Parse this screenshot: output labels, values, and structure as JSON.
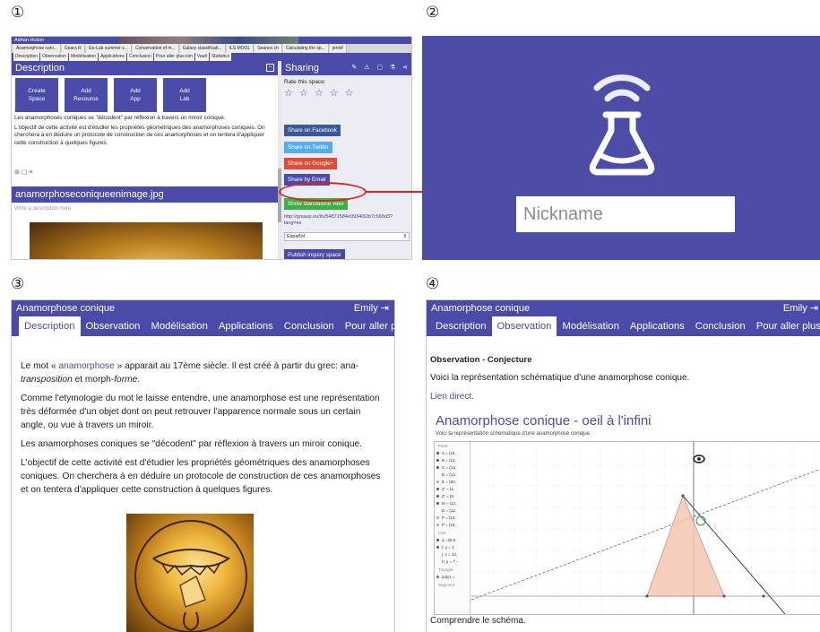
{
  "panel_labels": [
    "①",
    "②",
    "③",
    "④"
  ],
  "p1": {
    "user_name": "Adrian Holzer",
    "top_tabs": [
      "Anamorphose coni...",
      "Geara R",
      "Go-Lab summer s...",
      "Conservation of m...",
      "Galaxy classificati...",
      "ILS MOOL",
      "Seance.ch",
      "Calculating the sp...",
      "jennif"
    ],
    "sub_tabs": [
      "Description",
      "Observation",
      "Modélisation",
      "Applications",
      "Conclusion",
      "Pour aller plus loin",
      "Vault",
      "Statistics"
    ],
    "description_title": "Description",
    "actions": [
      "Create\nSpace",
      "Add\nResource",
      "Add\nApp",
      "Add\nLab"
    ],
    "desc_text_1": "Les anamorphoses coniques se \"décodent\" par réflexion à travers un miroir conique.",
    "desc_text_2": "L'objectif de cette activité est d'étudier les propriétés géométriques des anamorphoses coniques. On cherchera à en déduire un protocole de construction de ces anamorphoses et on tentera d'appliquer cette construction à quelques figures.",
    "mini_icons": "⊞ ▢ ≡",
    "file_title": "anamorphoseconiqueenimage.jpg",
    "file_placeholder": "Write a description here",
    "sharing_title": "Sharing",
    "sharing_tools": "✎ ⚠ ▢ ⚗ ⋖",
    "rate_label": "Rate this space:",
    "stars": "☆ ☆ ☆ ☆ ☆",
    "share_facebook": "Share on Facebook",
    "share_twitter": "Share on Twitter",
    "share_google": "Share on Google+",
    "share_email": "Share by Email",
    "standalone": "Show standalone view",
    "link": "http://graasp.eu/ils/54871584e99340t2b7c665d3?lang=es",
    "language": "Español",
    "publish": "Publish inquiry space",
    "colors": {
      "facebook": "#3b5998",
      "twitter": "#55acee",
      "google": "#dd4b39",
      "email": "#4a4aa8",
      "standalone": "#3cb043",
      "highlight": "#e02020"
    }
  },
  "p2": {
    "nickname_placeholder": "Nickname",
    "bg": "#4d4da8"
  },
  "p3": {
    "app_title": "Anamorphose conique",
    "user": "Emily",
    "tabs": [
      "Description",
      "Observation",
      "Modélisation",
      "Applications",
      "Conclusion",
      "Pour aller plus lo"
    ],
    "para1_a": "Le mot « ",
    "para1_link": "anamorphose",
    "para1_b": " » apparait au 17ème siècle. Il est créé à partir du grec: ana-",
    "para1_c": "transposition",
    "para1_d": " et morph-",
    "para1_e": "forme",
    "para1_f": ".",
    "para2": "Comme l'etymologie du mot le laisse entendre, une anamorphose est une représentation très déformée d'un objet dont on peut retrouver l'apparence normale sous un certain angle, ou vue à travers un miroir.",
    "para3": "Les anamorphoses coniques se \"décodent\" par réflexion à travers un miroir conique.",
    "para4": "L'objectif de cette activité est d'étudier les propriétés géométriques des anamorphoses coniques. On cherchera à en déduire un protocole de construction de ces anamorphoses et on tentera d'appliquer cette construction à quelques figures."
  },
  "p4": {
    "app_title": "Anamorphose conique",
    "user": "Emily",
    "tabs": [
      "Description",
      "Observation",
      "Modélisation",
      "Applications",
      "Conclusion",
      "Pour aller plus lo"
    ],
    "obs_title": "Observation - Conjecture",
    "obs_text": "Voici la représentation schématique d'une anamorphose conique.",
    "lien": "Lien direct.",
    "geo_title": "Anamorphose conique - oeil à l'infini",
    "geo_sub": "Voici la représentation schématique d'une anamorphose conique.",
    "algebra_rows": [
      "A = (10,",
      "B = (12,",
      "C = (14,",
      "D = (13,",
      "E = (60,",
      "Z' = (4,",
      "Z' = (8,",
      "M = (12,",
      "D = (12,",
      "P = (13,",
      "P = (16,"
    ],
    "algebra_section_line": "Line",
    "line_rows": [
      "a: -25.9",
      "f: y = 1",
      "j: x = 12,",
      "h: y = 7 -"
    ],
    "algebra_section_triangle": "Triangle",
    "triangle_row": "poly1 =",
    "algebra_section_segment": "Segment",
    "caption": "Comprendre le schéma."
  }
}
